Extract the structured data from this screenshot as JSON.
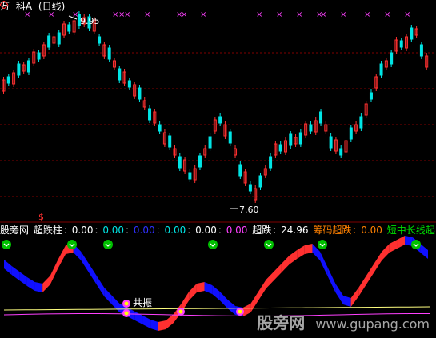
{
  "title": {
    "prefix": "万",
    "name": "科A",
    "period": "(日线)"
  },
  "price_high_label": "9.95",
  "price_low_label": "7.60",
  "marker_s": "$",
  "indicator": {
    "label_main": "股旁网",
    "items": [
      {
        "label": "超跌柱",
        "value": "0.00",
        "color": "#ffffff"
      },
      {
        "label": "",
        "value": "0.00",
        "color": "#00e5e5"
      },
      {
        "label": "",
        "value": "0.00",
        "color": "#3030ff"
      },
      {
        "label": "",
        "value": "0.00",
        "color": "#00e5e5"
      },
      {
        "label": "",
        "value": "0.00",
        "color": "#ffffff"
      },
      {
        "label": "",
        "value": "0.00",
        "color": "#ff40ff"
      }
    ],
    "chaodie_label": "超跌",
    "chaodie_value": "24.96",
    "chouma_label": "筹码超跌",
    "chouma_value": "0.00",
    "short_long_label": "短中长线起"
  },
  "resonance_label": "共振",
  "watermark": {
    "brand": "股旁网",
    "url": "www.gupang.com"
  },
  "colors": {
    "up": "#ff3030",
    "down": "#00e5e5",
    "blue_band": "#1010ff",
    "yellow_line": "#ffff80",
    "pink_line": "#ff40ff",
    "green_dot": "#00c000"
  }
}
